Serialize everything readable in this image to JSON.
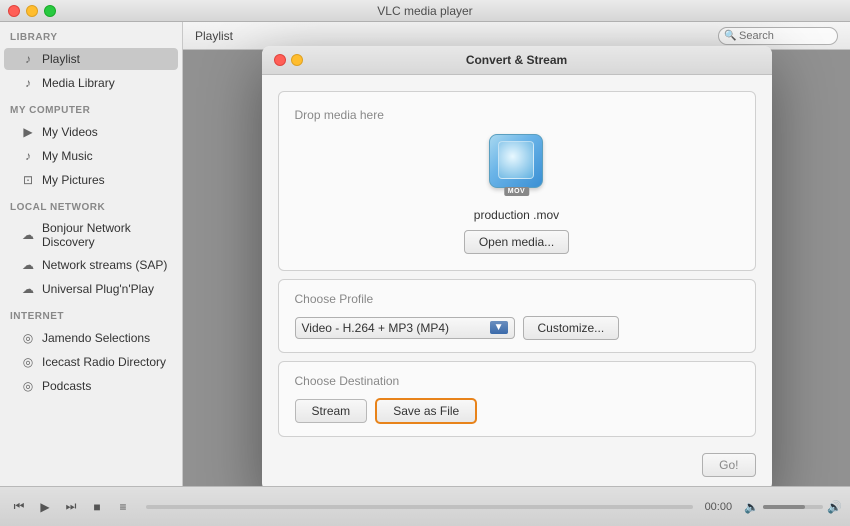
{
  "app": {
    "title": "VLC media player",
    "window_buttons": [
      "close",
      "minimize",
      "maximize"
    ]
  },
  "playlist_header": {
    "label": "Playlist"
  },
  "search": {
    "placeholder": "Search"
  },
  "sidebar": {
    "sections": [
      {
        "id": "library",
        "header": "LIBRARY",
        "items": [
          {
            "id": "playlist",
            "label": "Playlist",
            "icon": "♪",
            "active": true
          },
          {
            "id": "media-library",
            "label": "Media Library",
            "icon": "♪"
          }
        ]
      },
      {
        "id": "my-computer",
        "header": "MY COMPUTER",
        "items": [
          {
            "id": "my-videos",
            "label": "My Videos",
            "icon": "▶"
          },
          {
            "id": "my-music",
            "label": "My Music",
            "icon": "♪"
          },
          {
            "id": "my-pictures",
            "label": "My Pictures",
            "icon": "⊡"
          }
        ]
      },
      {
        "id": "local-network",
        "header": "LOCAL NETWORK",
        "items": [
          {
            "id": "bonjour",
            "label": "Bonjour Network Discovery",
            "icon": "☁"
          },
          {
            "id": "network-streams",
            "label": "Network streams (SAP)",
            "icon": "☁"
          },
          {
            "id": "universal-plug",
            "label": "Universal Plug'n'Play",
            "icon": "☁"
          }
        ]
      },
      {
        "id": "internet",
        "header": "INTERNET",
        "items": [
          {
            "id": "jamendo",
            "label": "Jamendo Selections",
            "icon": "◎"
          },
          {
            "id": "icecast",
            "label": "Icecast Radio Directory",
            "icon": "◎"
          },
          {
            "id": "podcasts",
            "label": "Podcasts",
            "icon": "◎"
          }
        ]
      }
    ]
  },
  "dialog": {
    "title": "Convert & Stream",
    "drop_zone_label": "Drop media here",
    "file_name": "production .mov",
    "file_ext": "MOV",
    "open_media_label": "Open media...",
    "choose_profile_label": "Choose Profile",
    "profile_value": "Video - H.264 + MP3 (MP4)",
    "customize_label": "Customize...",
    "choose_destination_label": "Choose Destination",
    "stream_label": "Stream",
    "save_as_file_label": "Save as File",
    "go_label": "Go!"
  },
  "playback": {
    "time": "00:00",
    "volume_pct": 70
  },
  "controls": {
    "prev": "⏮",
    "play": "▶",
    "next": "⏭",
    "stop": "■",
    "playlist_toggle": "≡"
  }
}
